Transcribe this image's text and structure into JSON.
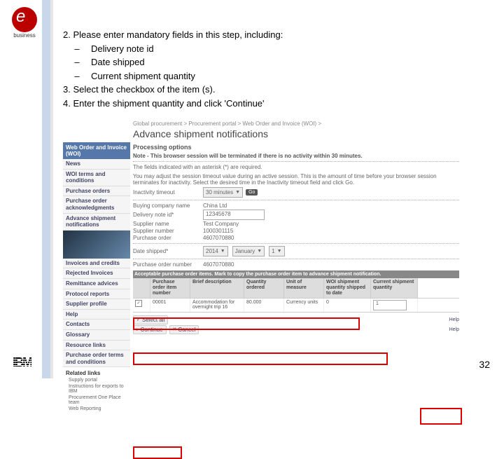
{
  "logo": {
    "sub": "business"
  },
  "instructions": {
    "line2": "2. Please enter mandatory fields in this step, including:",
    "bullets": [
      "Delivery note id",
      "Date shipped",
      "Current shipment quantity"
    ],
    "line3": "3. Select the checkbox of the item (s).",
    "line4": "4. Enter the shipment quantity and click 'Continue'"
  },
  "app": {
    "breadcrumb": "Global procurement > Procurement portal > Web Order and Invoice (WOI) >",
    "title": "Advance shipment notifications",
    "subtitle": "Processing options",
    "note": "Note - This browser session will be terminated if there is no activity within 30 minutes.",
    "required_text": "The fields indicated with an asterisk (*) are required.",
    "timeout_text": "You may adjust the session timeout value during an active session. This is the amount of time before your browser session terminates for inactivity. Select the desired time in the Inactivity timeout field and click Go.",
    "fields": {
      "inactivity_label": "Inactivity timeout",
      "inactivity_value": "30 minutes",
      "buying_label": "Buying company name",
      "buying_value": "China Ltd",
      "delivery_label": "Delivery note id*",
      "delivery_value": "12345678",
      "supplier_name_label": "Supplier name",
      "supplier_name_value": "Test Company",
      "supplier_num_label": "Supplier number",
      "supplier_num_value": "1000301115",
      "po_label": "Purchase order",
      "po_value": "4607070880",
      "date_label": "Date shipped*",
      "date_year": "2014",
      "date_month": "January",
      "date_day": "1",
      "po_num_label": "Purchase order number",
      "po_num_value": "4607070880"
    },
    "table_header": "Acceptable purchase order items. Mark to copy the purchase order item to advance shipment notification.",
    "columns": [
      "",
      "Purchase order item number",
      "Brief description",
      "Quantity ordered",
      "Unit of measure",
      "WOI shipment quantity shipped to date",
      "Current shipment quantity"
    ],
    "rows": [
      {
        "checked": true,
        "num": "00001",
        "desc": "Accommodation for overnight trip 16",
        "qty": "80.000",
        "uom": "Currency units",
        "shipped": "0",
        "current": "1"
      }
    ],
    "go": "Go",
    "select_all": "Select all",
    "continue": "Continue",
    "cancel": "Cancel",
    "help": "Help"
  },
  "sidebar": {
    "header": "Web Order and Invoice (WOI)",
    "items": [
      "News",
      "WOI terms and conditions",
      "Purchase orders",
      "Purchase order acknowledgments",
      "Advance shipment notifications",
      "Invoices and credits",
      "Rejected Invoices",
      "Remittance advices",
      "Protocol reports",
      "Supplier profile",
      "Help",
      "Contacts",
      "Glossary",
      "Resource links",
      "Purchase order terms and conditions"
    ],
    "related_header": "Related links",
    "related": [
      "Supply portal",
      "Instructions for exports to IBM",
      "Procurement One Place team",
      "Web Reporting"
    ]
  },
  "page_number": "32",
  "ibm": "IBM"
}
